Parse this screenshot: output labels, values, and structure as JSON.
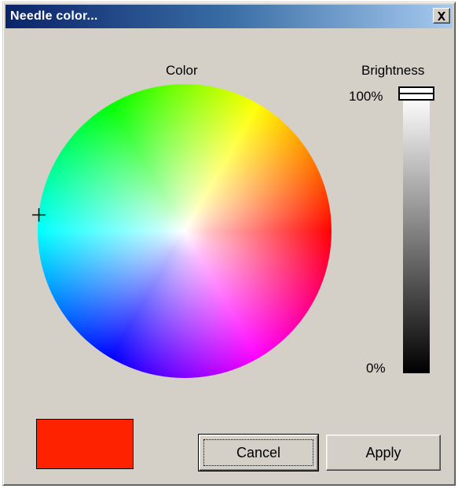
{
  "window": {
    "title": "Needle color..."
  },
  "color_wheel": {
    "label": "Color",
    "selected_color": "#ff2200"
  },
  "brightness": {
    "label": "Brightness",
    "max_label": "100%",
    "min_label": "0%",
    "value_percent": 100
  },
  "buttons": {
    "cancel_label": "Cancel",
    "apply_label": "Apply"
  },
  "icons": {
    "close": "close-icon",
    "crosshair": "crosshair-icon"
  },
  "colors": {
    "title_active_start": "#0a246a",
    "title_active_end": "#a6caf0",
    "dialog_face": "#d4d0c8",
    "preview_swatch": "#ff2200"
  }
}
